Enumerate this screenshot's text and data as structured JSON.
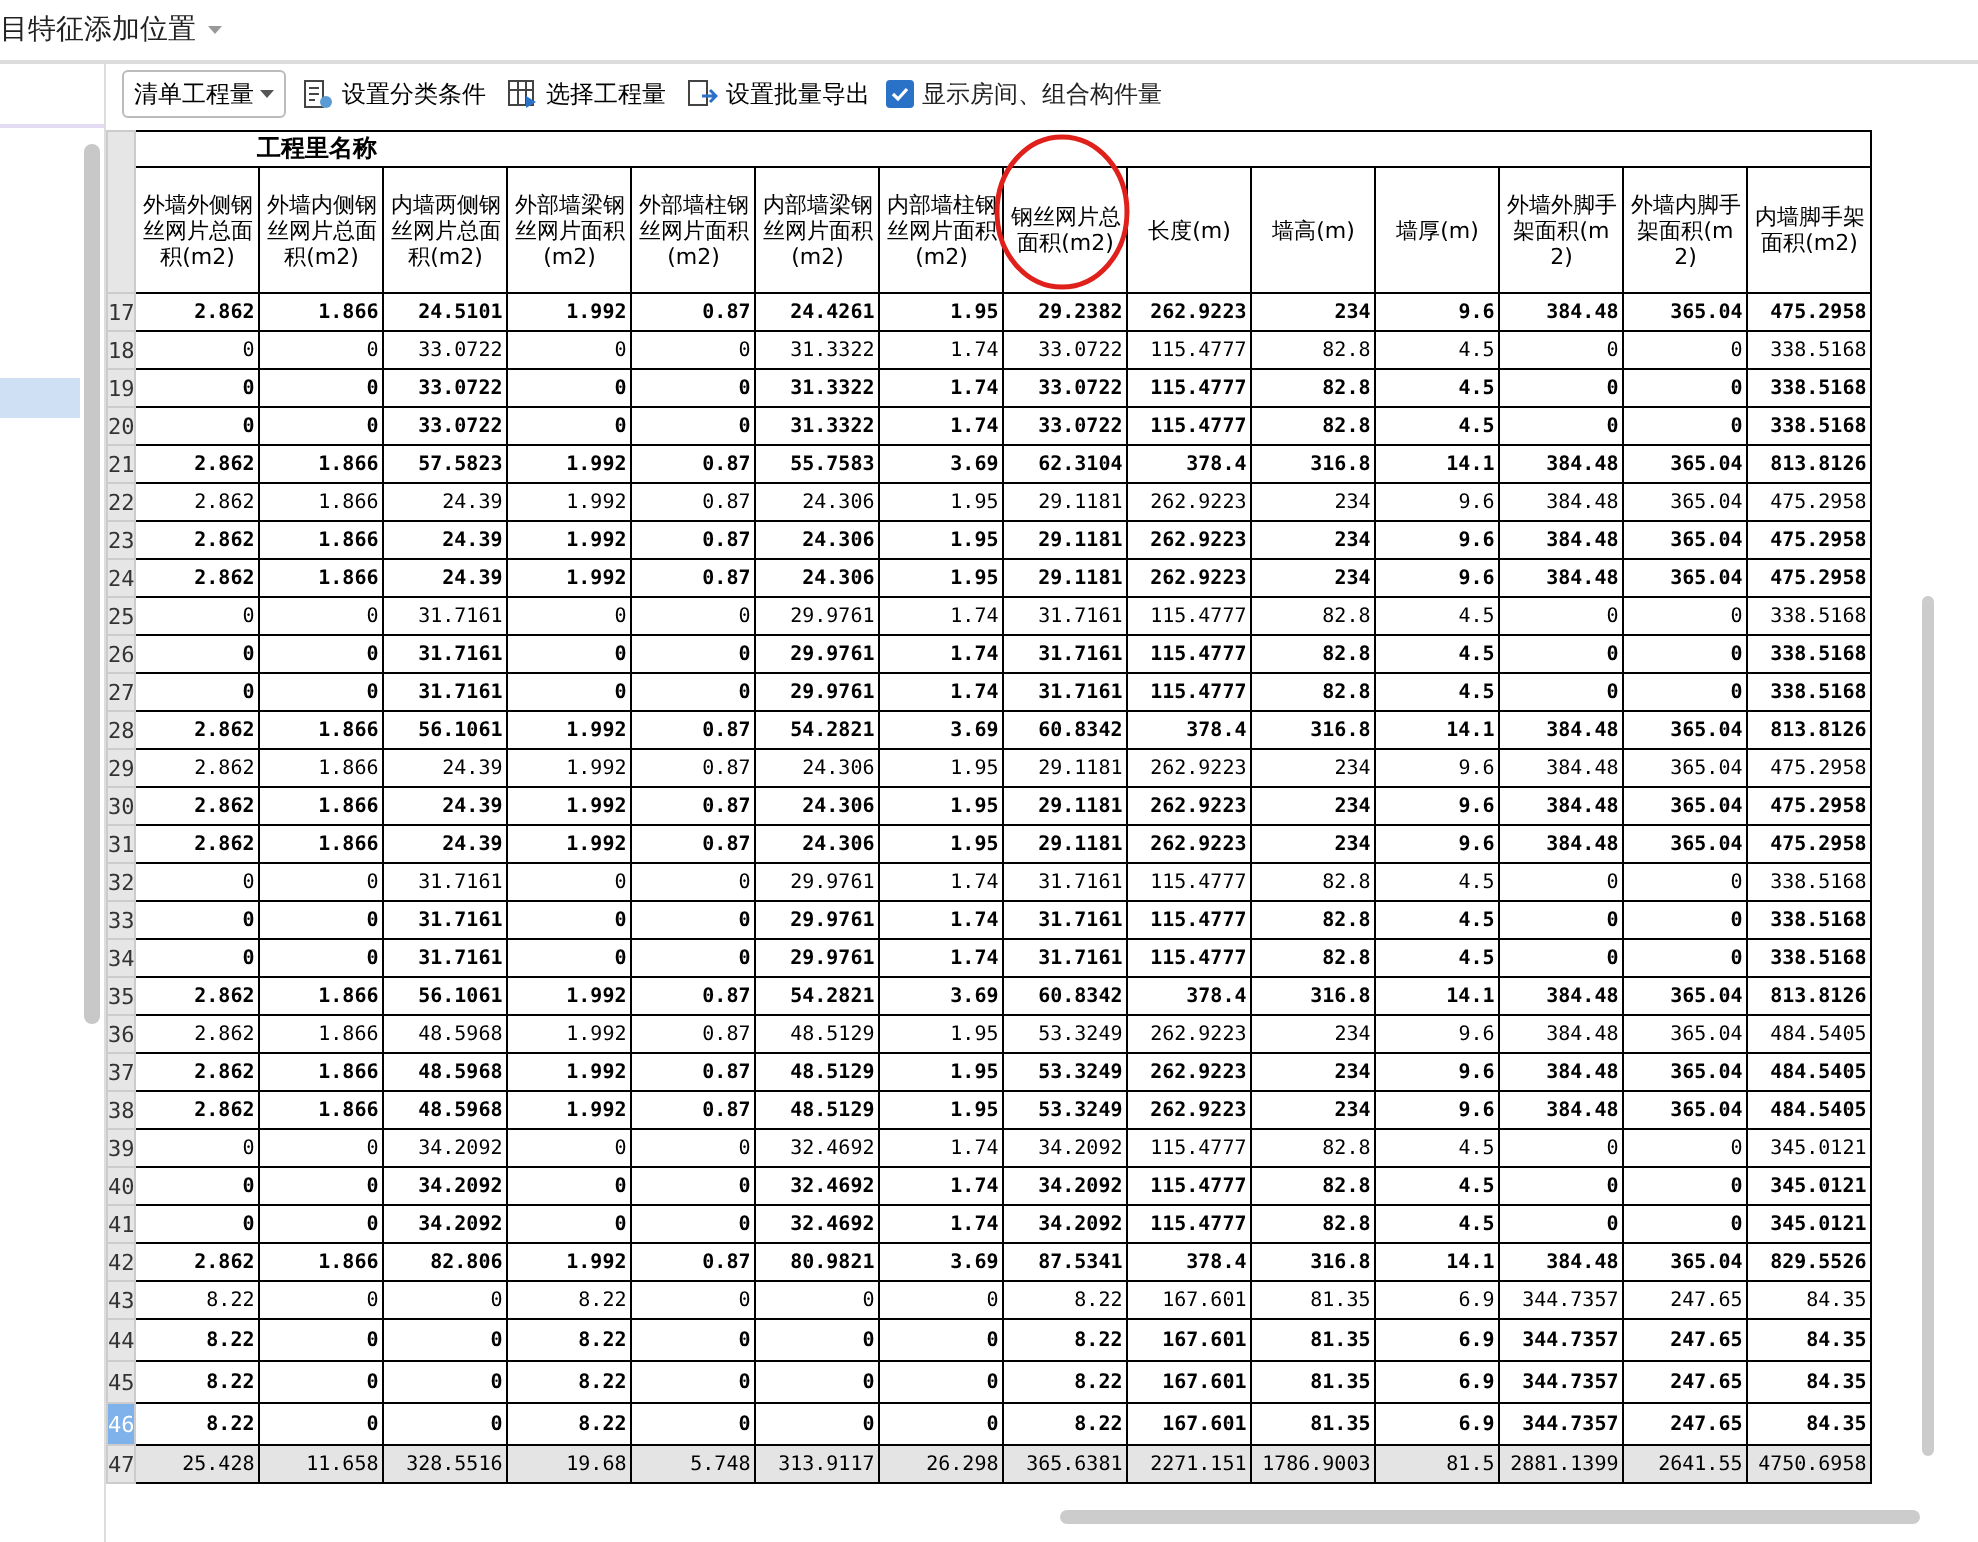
{
  "top_bar": {
    "label": "目特征添加位置"
  },
  "toolbar": {
    "dropdown": "清单工程量",
    "buttons": [
      {
        "kind": "classify",
        "label": "设置分类条件"
      },
      {
        "kind": "select",
        "label": "选择工程量"
      },
      {
        "kind": "export",
        "label": "设置批量导出"
      }
    ],
    "checkbox": {
      "label": "显示房间、组合构件量",
      "checked": true
    }
  },
  "table": {
    "group_header": "工程里名称",
    "columns": [
      {
        "label": "外墙外侧钢丝网片总面积(m2)",
        "circled": false
      },
      {
        "label": "外墙内侧钢丝网片总面积(m2)",
        "circled": false
      },
      {
        "label": "内墙两侧钢丝网片总面积(m2)",
        "circled": false
      },
      {
        "label": "外部墙梁钢丝网片面积(m2)",
        "circled": false
      },
      {
        "label": "外部墙柱钢丝网片面积(m2)",
        "circled": false
      },
      {
        "label": "内部墙梁钢丝网片面积(m2)",
        "circled": false
      },
      {
        "label": "内部墙柱钢丝网片面积(m2)",
        "circled": false
      },
      {
        "label": "钢丝网片总面积(m2)",
        "circled": true
      },
      {
        "label": "长度(m)",
        "circled": false
      },
      {
        "label": "墙高(m)",
        "circled": false
      },
      {
        "label": "墙厚(m)",
        "circled": false
      },
      {
        "label": "外墙外脚手架面积(m2)",
        "circled": false
      },
      {
        "label": "外墙内脚手架面积(m2)",
        "circled": false
      },
      {
        "label": "内墙脚手架面积(m2)",
        "circled": false
      }
    ],
    "rows": [
      {
        "num": "17",
        "kind": "bold",
        "selected": false,
        "cells": [
          "2.862",
          "1.866",
          "24.5101",
          "1.992",
          "0.87",
          "24.4261",
          "1.95",
          "29.2382",
          "262.9223",
          "234",
          "9.6",
          "384.48",
          "365.04",
          "475.2958"
        ]
      },
      {
        "num": "18",
        "kind": "normal",
        "selected": false,
        "cells": [
          "0",
          "0",
          "33.0722",
          "0",
          "0",
          "31.3322",
          "1.74",
          "33.0722",
          "115.4777",
          "82.8",
          "4.5",
          "0",
          "0",
          "338.5168"
        ]
      },
      {
        "num": "19",
        "kind": "bold",
        "selected": false,
        "cells": [
          "0",
          "0",
          "33.0722",
          "0",
          "0",
          "31.3322",
          "1.74",
          "33.0722",
          "115.4777",
          "82.8",
          "4.5",
          "0",
          "0",
          "338.5168"
        ]
      },
      {
        "num": "20",
        "kind": "bold",
        "selected": false,
        "cells": [
          "0",
          "0",
          "33.0722",
          "0",
          "0",
          "31.3322",
          "1.74",
          "33.0722",
          "115.4777",
          "82.8",
          "4.5",
          "0",
          "0",
          "338.5168"
        ]
      },
      {
        "num": "21",
        "kind": "bold",
        "selected": false,
        "cells": [
          "2.862",
          "1.866",
          "57.5823",
          "1.992",
          "0.87",
          "55.7583",
          "3.69",
          "62.3104",
          "378.4",
          "316.8",
          "14.1",
          "384.48",
          "365.04",
          "813.8126"
        ]
      },
      {
        "num": "22",
        "kind": "normal",
        "selected": false,
        "cells": [
          "2.862",
          "1.866",
          "24.39",
          "1.992",
          "0.87",
          "24.306",
          "1.95",
          "29.1181",
          "262.9223",
          "234",
          "9.6",
          "384.48",
          "365.04",
          "475.2958"
        ]
      },
      {
        "num": "23",
        "kind": "bold",
        "selected": false,
        "cells": [
          "2.862",
          "1.866",
          "24.39",
          "1.992",
          "0.87",
          "24.306",
          "1.95",
          "29.1181",
          "262.9223",
          "234",
          "9.6",
          "384.48",
          "365.04",
          "475.2958"
        ]
      },
      {
        "num": "24",
        "kind": "bold",
        "selected": false,
        "cells": [
          "2.862",
          "1.866",
          "24.39",
          "1.992",
          "0.87",
          "24.306",
          "1.95",
          "29.1181",
          "262.9223",
          "234",
          "9.6",
          "384.48",
          "365.04",
          "475.2958"
        ]
      },
      {
        "num": "25",
        "kind": "normal",
        "selected": false,
        "cells": [
          "0",
          "0",
          "31.7161",
          "0",
          "0",
          "29.9761",
          "1.74",
          "31.7161",
          "115.4777",
          "82.8",
          "4.5",
          "0",
          "0",
          "338.5168"
        ]
      },
      {
        "num": "26",
        "kind": "bold",
        "selected": false,
        "cells": [
          "0",
          "0",
          "31.7161",
          "0",
          "0",
          "29.9761",
          "1.74",
          "31.7161",
          "115.4777",
          "82.8",
          "4.5",
          "0",
          "0",
          "338.5168"
        ]
      },
      {
        "num": "27",
        "kind": "bold",
        "selected": false,
        "cells": [
          "0",
          "0",
          "31.7161",
          "0",
          "0",
          "29.9761",
          "1.74",
          "31.7161",
          "115.4777",
          "82.8",
          "4.5",
          "0",
          "0",
          "338.5168"
        ]
      },
      {
        "num": "28",
        "kind": "bold",
        "selected": false,
        "cells": [
          "2.862",
          "1.866",
          "56.1061",
          "1.992",
          "0.87",
          "54.2821",
          "3.69",
          "60.8342",
          "378.4",
          "316.8",
          "14.1",
          "384.48",
          "365.04",
          "813.8126"
        ]
      },
      {
        "num": "29",
        "kind": "normal",
        "selected": false,
        "cells": [
          "2.862",
          "1.866",
          "24.39",
          "1.992",
          "0.87",
          "24.306",
          "1.95",
          "29.1181",
          "262.9223",
          "234",
          "9.6",
          "384.48",
          "365.04",
          "475.2958"
        ]
      },
      {
        "num": "30",
        "kind": "bold",
        "selected": false,
        "cells": [
          "2.862",
          "1.866",
          "24.39",
          "1.992",
          "0.87",
          "24.306",
          "1.95",
          "29.1181",
          "262.9223",
          "234",
          "9.6",
          "384.48",
          "365.04",
          "475.2958"
        ]
      },
      {
        "num": "31",
        "kind": "bold",
        "selected": false,
        "cells": [
          "2.862",
          "1.866",
          "24.39",
          "1.992",
          "0.87",
          "24.306",
          "1.95",
          "29.1181",
          "262.9223",
          "234",
          "9.6",
          "384.48",
          "365.04",
          "475.2958"
        ]
      },
      {
        "num": "32",
        "kind": "normal",
        "selected": false,
        "cells": [
          "0",
          "0",
          "31.7161",
          "0",
          "0",
          "29.9761",
          "1.74",
          "31.7161",
          "115.4777",
          "82.8",
          "4.5",
          "0",
          "0",
          "338.5168"
        ]
      },
      {
        "num": "33",
        "kind": "bold",
        "selected": false,
        "cells": [
          "0",
          "0",
          "31.7161",
          "0",
          "0",
          "29.9761",
          "1.74",
          "31.7161",
          "115.4777",
          "82.8",
          "4.5",
          "0",
          "0",
          "338.5168"
        ]
      },
      {
        "num": "34",
        "kind": "bold",
        "selected": false,
        "cells": [
          "0",
          "0",
          "31.7161",
          "0",
          "0",
          "29.9761",
          "1.74",
          "31.7161",
          "115.4777",
          "82.8",
          "4.5",
          "0",
          "0",
          "338.5168"
        ]
      },
      {
        "num": "35",
        "kind": "bold",
        "selected": false,
        "cells": [
          "2.862",
          "1.866",
          "56.1061",
          "1.992",
          "0.87",
          "54.2821",
          "3.69",
          "60.8342",
          "378.4",
          "316.8",
          "14.1",
          "384.48",
          "365.04",
          "813.8126"
        ]
      },
      {
        "num": "36",
        "kind": "normal",
        "selected": false,
        "cells": [
          "2.862",
          "1.866",
          "48.5968",
          "1.992",
          "0.87",
          "48.5129",
          "1.95",
          "53.3249",
          "262.9223",
          "234",
          "9.6",
          "384.48",
          "365.04",
          "484.5405"
        ]
      },
      {
        "num": "37",
        "kind": "bold",
        "selected": false,
        "cells": [
          "2.862",
          "1.866",
          "48.5968",
          "1.992",
          "0.87",
          "48.5129",
          "1.95",
          "53.3249",
          "262.9223",
          "234",
          "9.6",
          "384.48",
          "365.04",
          "484.5405"
        ]
      },
      {
        "num": "38",
        "kind": "bold",
        "selected": false,
        "cells": [
          "2.862",
          "1.866",
          "48.5968",
          "1.992",
          "0.87",
          "48.5129",
          "1.95",
          "53.3249",
          "262.9223",
          "234",
          "9.6",
          "384.48",
          "365.04",
          "484.5405"
        ]
      },
      {
        "num": "39",
        "kind": "normal",
        "selected": false,
        "cells": [
          "0",
          "0",
          "34.2092",
          "0",
          "0",
          "32.4692",
          "1.74",
          "34.2092",
          "115.4777",
          "82.8",
          "4.5",
          "0",
          "0",
          "345.0121"
        ]
      },
      {
        "num": "40",
        "kind": "bold",
        "selected": false,
        "cells": [
          "0",
          "0",
          "34.2092",
          "0",
          "0",
          "32.4692",
          "1.74",
          "34.2092",
          "115.4777",
          "82.8",
          "4.5",
          "0",
          "0",
          "345.0121"
        ]
      },
      {
        "num": "41",
        "kind": "bold",
        "selected": false,
        "cells": [
          "0",
          "0",
          "34.2092",
          "0",
          "0",
          "32.4692",
          "1.74",
          "34.2092",
          "115.4777",
          "82.8",
          "4.5",
          "0",
          "0",
          "345.0121"
        ]
      },
      {
        "num": "42",
        "kind": "bold",
        "selected": false,
        "cells": [
          "2.862",
          "1.866",
          "82.806",
          "1.992",
          "0.87",
          "80.9821",
          "3.69",
          "87.5341",
          "378.4",
          "316.8",
          "14.1",
          "384.48",
          "365.04",
          "829.5526"
        ]
      },
      {
        "num": "43",
        "kind": "normal",
        "selected": false,
        "cells": [
          "8.22",
          "0",
          "0",
          "8.22",
          "0",
          "0",
          "0",
          "8.22",
          "167.601",
          "81.35",
          "6.9",
          "344.7357",
          "247.65",
          "84.35"
        ]
      },
      {
        "num": "44",
        "kind": "bold",
        "selected": false,
        "cells": [
          "8.22",
          "0",
          "0",
          "8.22",
          "0",
          "0",
          "0",
          "8.22",
          "167.601",
          "81.35",
          "6.9",
          "344.7357",
          "247.65",
          "84.35"
        ]
      },
      {
        "num": "45",
        "kind": "bold",
        "selected": false,
        "cells": [
          "8.22",
          "0",
          "0",
          "8.22",
          "0",
          "0",
          "0",
          "8.22",
          "167.601",
          "81.35",
          "6.9",
          "344.7357",
          "247.65",
          "84.35"
        ]
      },
      {
        "num": "46",
        "kind": "bold",
        "selected": true,
        "cells": [
          "8.22",
          "0",
          "0",
          "8.22",
          "0",
          "0",
          "0",
          "8.22",
          "167.601",
          "81.35",
          "6.9",
          "344.7357",
          "247.65",
          "84.35"
        ]
      },
      {
        "num": "47",
        "kind": "total",
        "selected": false,
        "cells": [
          "25.428",
          "11.658",
          "328.5516",
          "19.68",
          "5.748",
          "313.9117",
          "26.298",
          "365.6381",
          "2271.151",
          "1786.9003",
          "81.5",
          "2881.1399",
          "2641.55",
          "4750.6958"
        ]
      }
    ]
  }
}
